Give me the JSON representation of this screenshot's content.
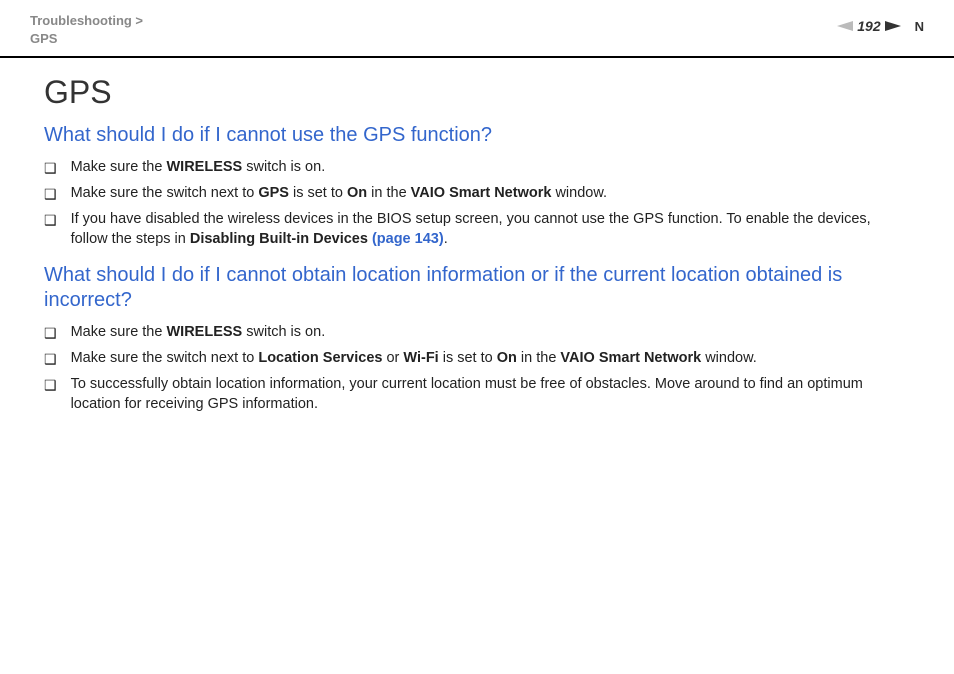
{
  "header": {
    "breadcrumb_top": "Troubleshooting >",
    "breadcrumb_bottom": "GPS",
    "page_number": "192",
    "n_marker": "N"
  },
  "content": {
    "page_title": "GPS",
    "section1": {
      "heading": "What should I do if I cannot use the GPS function?",
      "items": {
        "0": {
          "pre1": "Make sure the ",
          "bold1": "WIRELESS",
          "post1": " switch is on."
        },
        "1": {
          "pre1": "Make sure the switch next to ",
          "bold1": "GPS",
          "mid1": " is set to ",
          "bold2": "On",
          "mid2": " in the ",
          "bold3": "VAIO Smart Network",
          "post1": " window."
        },
        "2": {
          "pre1": "If you have disabled the wireless devices in the BIOS setup screen, you cannot use the GPS function. To enable the devices, follow the steps in ",
          "bold1": "Disabling Built-in Devices ",
          "link1": "(page 143)",
          "post1": "."
        }
      }
    },
    "section2": {
      "heading": "What should I do if I cannot obtain location information or if the current location obtained is incorrect?",
      "items": {
        "0": {
          "pre1": "Make sure the ",
          "bold1": "WIRELESS",
          "post1": " switch is on."
        },
        "1": {
          "pre1": "Make sure the switch next to ",
          "bold1": "Location Services",
          "mid1": " or ",
          "bold2": "Wi-Fi",
          "mid2": " is set to ",
          "bold3": "On",
          "mid3": " in the ",
          "bold4": "VAIO Smart Network",
          "post1": " window."
        },
        "2": {
          "pre1": "To successfully obtain location information, your current location must be free of obstacles. Move around to find an optimum location for receiving GPS information."
        }
      }
    }
  }
}
